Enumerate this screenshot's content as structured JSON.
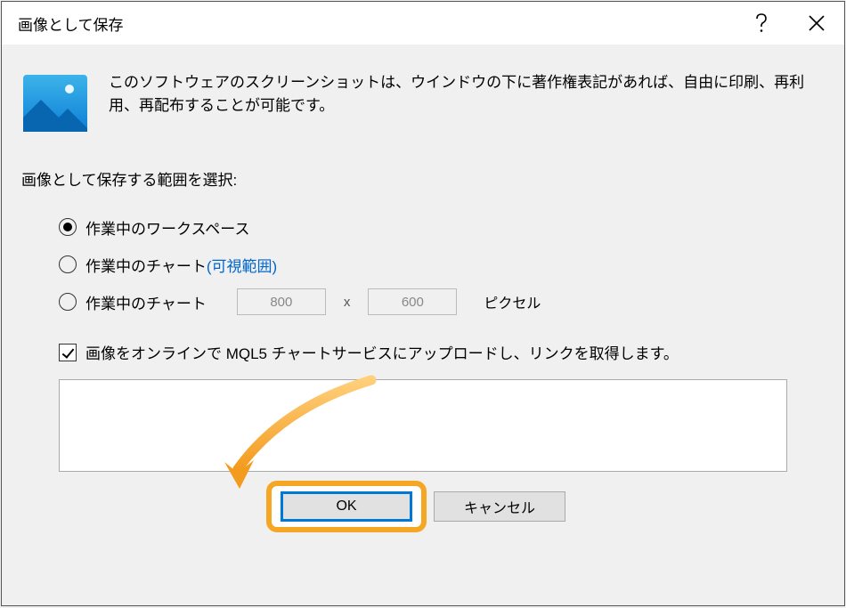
{
  "titlebar": {
    "title": "画像として保存"
  },
  "intro": {
    "text": "このソフトウェアのスクリーンショットは、ウインドウの下に著作権表記があれば、自由に印刷、再利用、再配布することが可能です。"
  },
  "section_label": "画像として保存する範囲を選択:",
  "radios": {
    "workspace": "作業中のワークスペース",
    "chart_visible_prefix": "作業中のチャート",
    "chart_visible_link": "(可視範囲)",
    "chart_size": "作業中のチャート",
    "width": "800",
    "height": "600",
    "x": "x",
    "unit": "ピクセル"
  },
  "checkbox": {
    "label": "画像をオンラインで MQL5 チャートサービスにアップロードし、リンクを取得します。"
  },
  "buttons": {
    "ok": "OK",
    "cancel": "キャンセル"
  }
}
